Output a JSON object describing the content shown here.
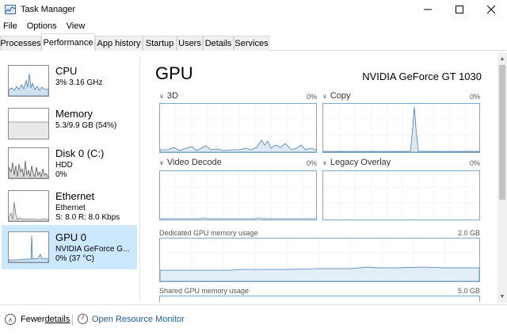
{
  "window": {
    "title": "Task Manager"
  },
  "menu": [
    "File",
    "Options",
    "View"
  ],
  "tabs": [
    {
      "label": "Processes",
      "active": false
    },
    {
      "label": "Performance",
      "active": true
    },
    {
      "label": "App history",
      "active": false
    },
    {
      "label": "Startup",
      "active": false
    },
    {
      "label": "Users",
      "active": false
    },
    {
      "label": "Details",
      "active": false
    },
    {
      "label": "Services",
      "active": false
    }
  ],
  "sidebar": {
    "items": [
      {
        "title": "CPU",
        "line1": "3% 3.16 GHz",
        "line2": "",
        "selected": false
      },
      {
        "title": "Memory",
        "line1": "5.3/9.9 GB (54%)",
        "line2": "",
        "selected": false
      },
      {
        "title": "Disk 0 (C:)",
        "line1": "HDD",
        "line2": "0%",
        "selected": false
      },
      {
        "title": "Ethernet",
        "line1": "Ethernet",
        "line2": "S: 8.0  R: 8.0 Kbps",
        "selected": false
      },
      {
        "title": "GPU 0",
        "line1": "NVIDIA GeForce G...",
        "line2": "0% (37 °C)",
        "selected": true
      }
    ]
  },
  "main": {
    "title": "GPU",
    "gpu_name": "NVIDIA GeForce GT 1030",
    "graphs": [
      {
        "label": "3D",
        "percent": "0%"
      },
      {
        "label": "Copy",
        "percent": "0%"
      },
      {
        "label": "Video Decode",
        "percent": "0%"
      },
      {
        "label": "Legacy Overlay",
        "percent": "0%"
      }
    ],
    "dedicated_memory": {
      "label": "Dedicated GPU memory usage",
      "value": "2.0 GB"
    },
    "shared_memory": {
      "label": "Shared GPU memory usage",
      "value": "5.0 GB"
    }
  },
  "footer": {
    "fewer_details_pre": "Fewer ",
    "fewer_details_link": "details",
    "resource_monitor": "Open Resource Monitor"
  },
  "colors": {
    "selected_bg": "#cce8ff",
    "graph_border": "#7fa7c3",
    "graph_line": "#4a80ad",
    "link": "#1e5c9e"
  }
}
